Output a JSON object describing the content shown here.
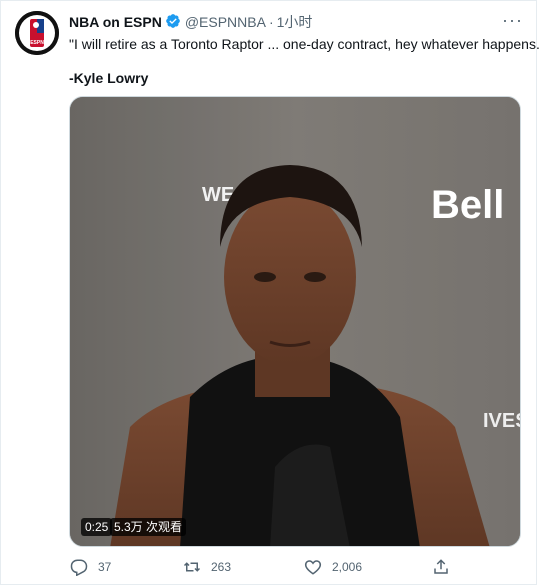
{
  "tweet": {
    "display_name": "NBA on ESPN",
    "handle": "@ESPNNBA",
    "separator": "·",
    "time": "1小时",
    "text_line1": "\"I will retire as a Toronto Raptor ... one-day contract, hey whatever happens.\"",
    "text_line2": "-Kyle Lowry",
    "more_label": "···"
  },
  "media": {
    "duration": "0:25",
    "views": "5.3万 次观看",
    "backdrop_text_left": "WE N",
    "backdrop_brand": "Bell",
    "backdrop_text_right": "IVES"
  },
  "actions": {
    "replies": "37",
    "retweets": "263",
    "likes": "2,006"
  },
  "colors": {
    "verified": "#1d9bf0",
    "muted": "#536471",
    "text": "#0f1419"
  },
  "icons": [
    "nba-espn-logo",
    "verified-badge-icon",
    "more-icon",
    "reply-icon",
    "retweet-icon",
    "like-icon",
    "share-icon"
  ]
}
